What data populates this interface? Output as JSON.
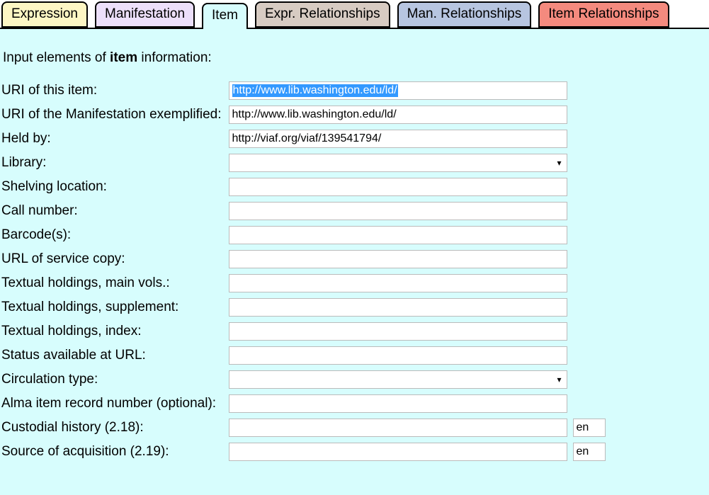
{
  "tabs": [
    {
      "label": "Expression",
      "bg": "#fdf6c4"
    },
    {
      "label": "Manifestation",
      "bg": "#ecdffa"
    },
    {
      "label": "Item",
      "bg": "#d7fdfd"
    },
    {
      "label": "Expr. Relationships",
      "bg": "#d7cbc2"
    },
    {
      "label": "Man. Relationships",
      "bg": "#b7c5e0"
    },
    {
      "label": "Item Relationships",
      "bg": "#f48a7e"
    }
  ],
  "active_tab_index": 2,
  "instruction": {
    "pre": "Input elements of ",
    "bold": "item",
    "post": " information:"
  },
  "fields": {
    "uri_item": {
      "label": "URI of this item:",
      "value": "http://www.lib.washington.edu/ld/"
    },
    "uri_manifest": {
      "label": "URI of the Manifestation exemplified:",
      "value": "http://www.lib.washington.edu/ld/"
    },
    "held_by": {
      "label": "Held by:",
      "value": "http://viaf.org/viaf/139541794/"
    },
    "library": {
      "label": "Library:",
      "value": ""
    },
    "shelving": {
      "label": "Shelving location:",
      "value": ""
    },
    "callnum": {
      "label": "Call number:",
      "value": ""
    },
    "barcodes": {
      "label": "Barcode(s):",
      "value": ""
    },
    "service_url": {
      "label": "URL of service copy:",
      "value": ""
    },
    "hold_main": {
      "label": "Textual holdings, main vols.:",
      "value": ""
    },
    "hold_supp": {
      "label": "Textual holdings, supplement:",
      "value": ""
    },
    "hold_index": {
      "label": "Textual holdings, index:",
      "value": ""
    },
    "status_url": {
      "label": "Status available at URL:",
      "value": ""
    },
    "circ_type": {
      "label": "Circulation type:",
      "value": ""
    },
    "alma": {
      "label": "Alma item record number (optional):",
      "value": ""
    },
    "custodial": {
      "label": "Custodial history (2.18):",
      "value": "",
      "lang": "en"
    },
    "source_acq": {
      "label": "Source of acquisition (2.19):",
      "value": "",
      "lang": "en"
    }
  }
}
